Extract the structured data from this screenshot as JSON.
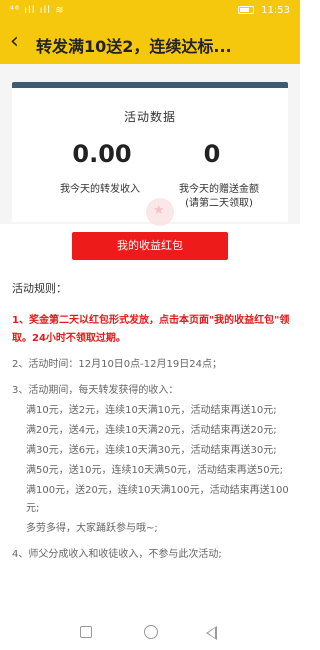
{
  "status_bar": {
    "signal": "⁴⁶ ıll ıll ≋",
    "network": "4G",
    "time": "11:53"
  },
  "nav": {
    "back_icon": "‹",
    "title": "转发满10送2，连续达标..."
  },
  "stats_card": {
    "title": "活动数据",
    "forward_income_value": "0.00",
    "forward_income_label": "我今天的转发收入",
    "gift_amount_value": "0",
    "gift_amount_label": "我今天的赠送金额",
    "gift_amount_note": "(请第二天领取)"
  },
  "button": {
    "label": "我的收益红包"
  },
  "rules": {
    "title": "活动规则：",
    "rule1": "1、奖金第二天以红包形式发放，点击本页面\"我的收益红包\"领取。24小时不领取过期。",
    "rule2": "2、活动时间：12月10日0点-12月19日24点；",
    "rule3": "3、活动期间，每天转发获得的收入：",
    "rule3_lines": [
      "满10元，送2元，连续10天满10元，活动结束再送10元;",
      "满20元，送4元，连续10天满20元，活动结束再送20元;",
      "满30元，送6元，连续10天满30元，活动结束再送30元;",
      "满50元，送10元，连续10天满50元，活动结束再送50元;",
      "满100元，送20元，连续10天满100元，活动结束再送100元;",
      "多劳多得，大家踊跃参与哦~;"
    ],
    "rule4": "4、师父分成收入和收徒收入，不参与此次活动;"
  },
  "colors": {
    "header": "#f6c80d",
    "card_accent": "#3d5a73",
    "button": "#ee1b1b",
    "highlight_text": "#e21a1a"
  }
}
